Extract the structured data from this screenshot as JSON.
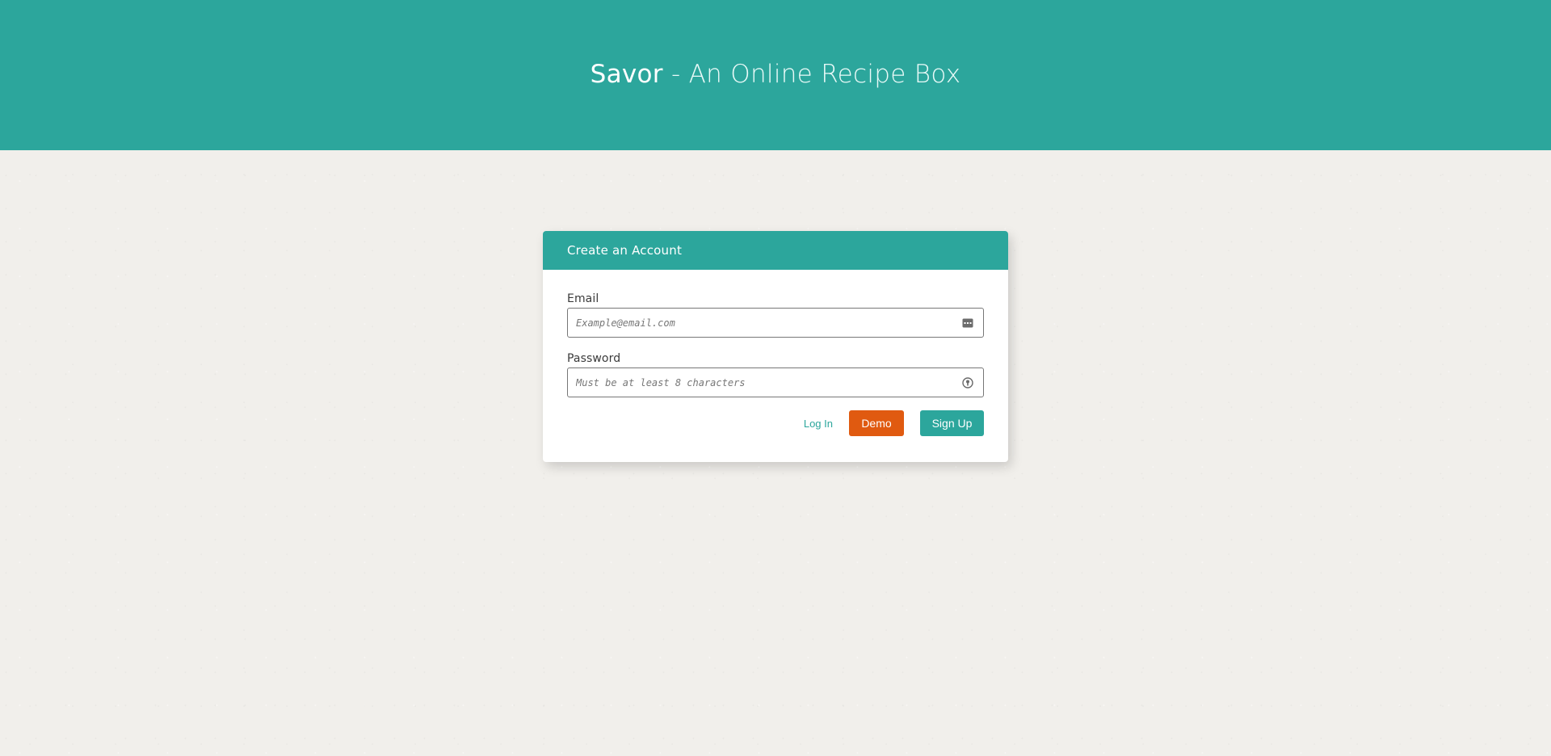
{
  "header": {
    "brand": "Savor",
    "separator": " - ",
    "tagline": "An Online Recipe Box"
  },
  "form": {
    "title": "Create an Account",
    "email": {
      "label": "Email",
      "placeholder": "Example@email.com",
      "value": "",
      "icon": "autofill-card-icon"
    },
    "password": {
      "label": "Password",
      "placeholder": "Must be at least 8 characters",
      "value": "",
      "icon": "password-key-icon"
    },
    "actions": {
      "login_label": "Log In",
      "demo_label": "Demo",
      "signup_label": "Sign Up"
    }
  },
  "colors": {
    "primary": "#2ca69c",
    "demo": "#e05a10",
    "background": "#f1efeb"
  }
}
